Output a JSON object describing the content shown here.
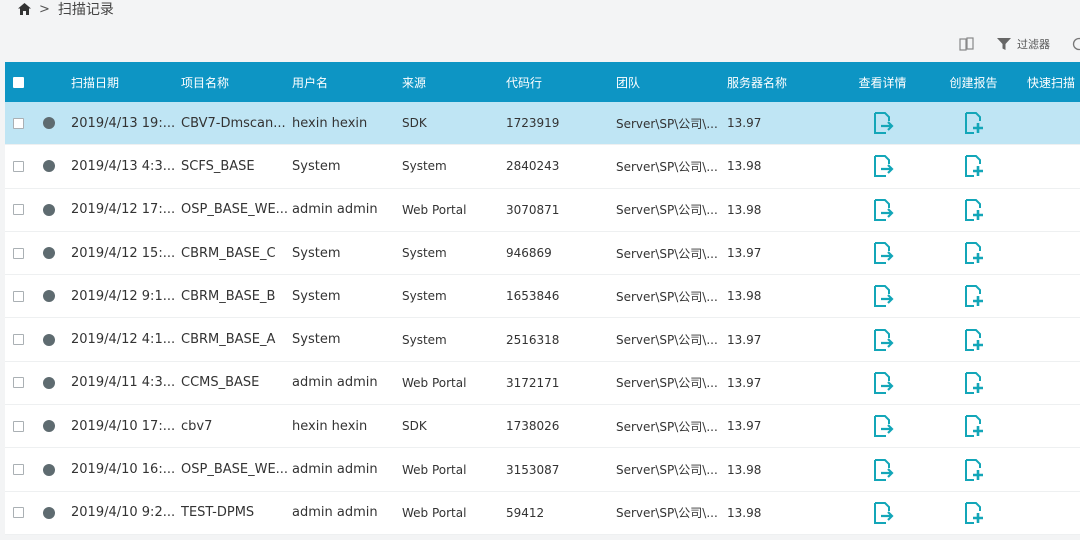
{
  "breadcrumb": {
    "home_icon": "home-icon",
    "separator": ">",
    "current": "扫描记录"
  },
  "toolbar": {
    "columns_icon": "columns-icon",
    "filter_icon": "filter-icon",
    "filter_label": "过滤器"
  },
  "table": {
    "headers": {
      "date": "扫描日期",
      "project": "项目名称",
      "user": "用户名",
      "source": "来源",
      "lines": "代码行",
      "team": "团队",
      "server": "服务器名称",
      "view": "查看详情",
      "create": "创建报告",
      "rescan": "快速扫描"
    },
    "rows": [
      {
        "date": "2019/4/13 19:...",
        "project": "CBV7-Dmscan...",
        "user": "hexin hexin",
        "source": "SDK",
        "lines": "1723919",
        "team": "Server\\SP\\公司\\...",
        "server": "13.97"
      },
      {
        "date": "2019/4/13 4:3...",
        "project": "SCFS_BASE",
        "user": "System",
        "source": "System",
        "lines": "2840243",
        "team": "Server\\SP\\公司\\...",
        "server": "13.98"
      },
      {
        "date": "2019/4/12 17:...",
        "project": "OSP_BASE_WE...",
        "user": "admin admin",
        "source": "Web Portal",
        "lines": "3070871",
        "team": "Server\\SP\\公司\\...",
        "server": "13.98"
      },
      {
        "date": "2019/4/12 15:...",
        "project": "CBRM_BASE_C",
        "user": "System",
        "source": "System",
        "lines": "946869",
        "team": "Server\\SP\\公司\\...",
        "server": "13.97"
      },
      {
        "date": "2019/4/12 9:1...",
        "project": "CBRM_BASE_B",
        "user": "System",
        "source": "System",
        "lines": "1653846",
        "team": "Server\\SP\\公司\\...",
        "server": "13.98"
      },
      {
        "date": "2019/4/12 4:1...",
        "project": "CBRM_BASE_A",
        "user": "System",
        "source": "System",
        "lines": "2516318",
        "team": "Server\\SP\\公司\\...",
        "server": "13.97"
      },
      {
        "date": "2019/4/11 4:3...",
        "project": "CCMS_BASE",
        "user": "admin admin",
        "source": "Web Portal",
        "lines": "3172171",
        "team": "Server\\SP\\公司\\...",
        "server": "13.97"
      },
      {
        "date": "2019/4/10 17:...",
        "project": "cbv7",
        "user": "hexin hexin",
        "source": "SDK",
        "lines": "1738026",
        "team": "Server\\SP\\公司\\...",
        "server": "13.97"
      },
      {
        "date": "2019/4/10 16:...",
        "project": "OSP_BASE_WE...",
        "user": "admin admin",
        "source": "Web Portal",
        "lines": "3153087",
        "team": "Server\\SP\\公司\\...",
        "server": "13.98"
      },
      {
        "date": "2019/4/10 9:2...",
        "project": "TEST-DPMS",
        "user": "admin admin",
        "source": "Web Portal",
        "lines": "59412",
        "team": "Server\\SP\\公司\\...",
        "server": "13.98"
      }
    ]
  },
  "colors": {
    "header_bg": "#0d95c4",
    "selected_row": "#bfe5f4",
    "action_icon": "#13a6b8",
    "status_dot": "#5e6b70"
  }
}
